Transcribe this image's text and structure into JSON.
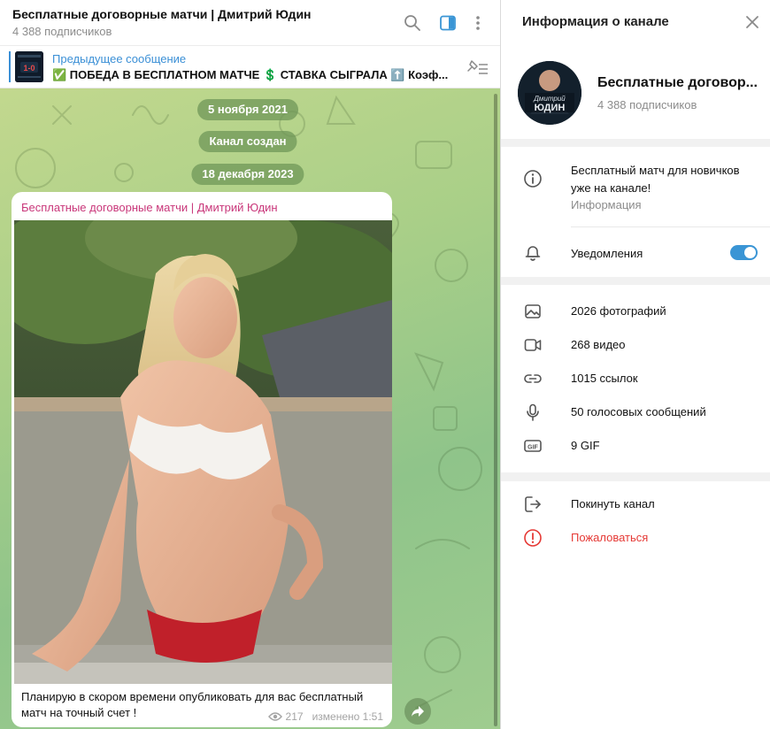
{
  "chat": {
    "title": "Бесплатные договорные матчи | Дмитрий Юдин",
    "subscribers": "4 388 подписчиков",
    "pinned": {
      "title": "Предыдущее сообщение",
      "text": "✅ ПОБЕДА В БЕСПЛАТНОМ МАТЧЕ 💲 СТАВКА СЫГРАЛА ⬆️ Коэф...",
      "thumb_text": "1-0"
    },
    "dates": [
      "5 ноября 2021",
      "Канал создан",
      "18 декабря 2023"
    ],
    "message": {
      "author": "Бесплатные договорные матчи | Дмитрий Юдин",
      "caption": "Планирую в скором времени опубликовать для вас бесплатный матч на точный счет !",
      "views": "217",
      "edited": "изменено 1:51"
    }
  },
  "info": {
    "header_title": "Информация о канале",
    "channel_name": "Бесплатные договор...",
    "subscribers": "4 388 подписчиков",
    "avatar_text_top": "Дмитрий",
    "avatar_text_bottom": "ЮДИН",
    "about_text": "Бесплатный матч для новичков уже на канале!",
    "about_label": "Информация",
    "notifications_label": "Уведомления",
    "notifications_on": true,
    "media": [
      {
        "icon": "photo-icon",
        "label": "2026 фотографий"
      },
      {
        "icon": "video-icon",
        "label": "268 видео"
      },
      {
        "icon": "link-icon",
        "label": "1015 ссылок"
      },
      {
        "icon": "mic-icon",
        "label": "50 голосовых сообщений"
      },
      {
        "icon": "gif-icon",
        "label": "9 GIF"
      }
    ],
    "actions": [
      {
        "icon": "leave-icon",
        "label": "Покинуть канал",
        "color": "#111111"
      },
      {
        "icon": "report-icon",
        "label": "Пожаловаться",
        "color": "#e53935"
      }
    ]
  },
  "colors": {
    "accent": "#3a95d5",
    "author": "#c9377a",
    "danger": "#e53935",
    "chat_bg": "#a9cf88"
  }
}
